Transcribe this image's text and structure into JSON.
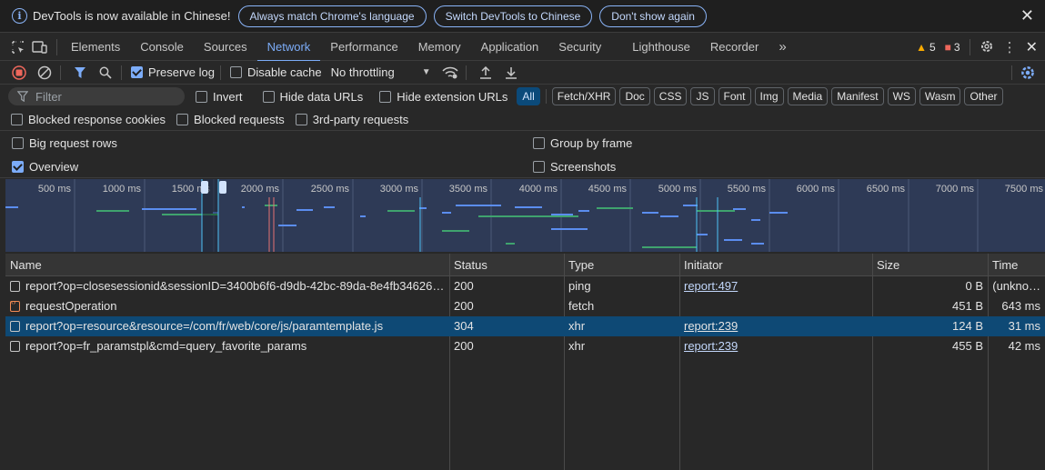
{
  "infobar": {
    "message": "DevTools is now available in Chinese!",
    "btn_match": "Always match Chrome's language",
    "btn_switch": "Switch DevTools to Chinese",
    "btn_dont_show": "Don't show again"
  },
  "tabs": [
    "Elements",
    "Console",
    "Sources",
    "Network",
    "Performance",
    "Memory",
    "Application",
    "Security",
    "Lighthouse",
    "Recorder"
  ],
  "active_tab": "Network",
  "counts": {
    "warnings": "5",
    "issues": "3"
  },
  "toolbar": {
    "preserve_log": "Preserve log",
    "disable_cache": "Disable cache",
    "throttling": "No throttling"
  },
  "filter": {
    "placeholder": "Filter",
    "invert": "Invert",
    "hide_data_urls": "Hide data URLs",
    "hide_extension_urls": "Hide extension URLs",
    "types": [
      "All",
      "Fetch/XHR",
      "Doc",
      "CSS",
      "JS",
      "Font",
      "Img",
      "Media",
      "Manifest",
      "WS",
      "Wasm",
      "Other"
    ],
    "selected_type": "All",
    "blocked_response_cookies": "Blocked response cookies",
    "blocked_requests": "Blocked requests",
    "third_party_requests": "3rd-party requests"
  },
  "options": {
    "big_request_rows": "Big request rows",
    "group_by_frame": "Group by frame",
    "overview": "Overview",
    "screenshots": "Screenshots"
  },
  "overview_ticks": [
    "500 ms",
    "1000 ms",
    "1500 ms",
    "2000 ms",
    "2500 ms",
    "3000 ms",
    "3500 ms",
    "4000 ms",
    "4500 ms",
    "5000 ms",
    "5500 ms",
    "6000 ms",
    "6500 ms",
    "7000 ms",
    "7500 ms"
  ],
  "table": {
    "columns": [
      "Name",
      "Status",
      "Type",
      "Initiator",
      "Size",
      "Time"
    ],
    "rows": [
      {
        "name": "report?op=closesessionid&sessionID=3400b6f6-d9db-42bc-89da-8e4fb34626…",
        "status": "200",
        "type": "ping",
        "initiator": "report:497",
        "size": "0 B",
        "time": "(unkno…",
        "icon": "doc"
      },
      {
        "name": "requestOperation",
        "status": "200",
        "type": "fetch",
        "initiator": "",
        "size": "451 B",
        "time": "643 ms",
        "icon": "fetch"
      },
      {
        "name": "report?op=resource&resource=/com/fr/web/core/js/paramtemplate.js",
        "status": "304",
        "type": "xhr",
        "initiator": "report:239",
        "size": "124 B",
        "time": "31 ms",
        "icon": "doc"
      },
      {
        "name": "report?op=fr_paramstpl&cmd=query_favorite_params",
        "status": "200",
        "type": "xhr",
        "initiator": "report:239",
        "size": "455 B",
        "time": "42 ms",
        "icon": "doc"
      }
    ]
  }
}
